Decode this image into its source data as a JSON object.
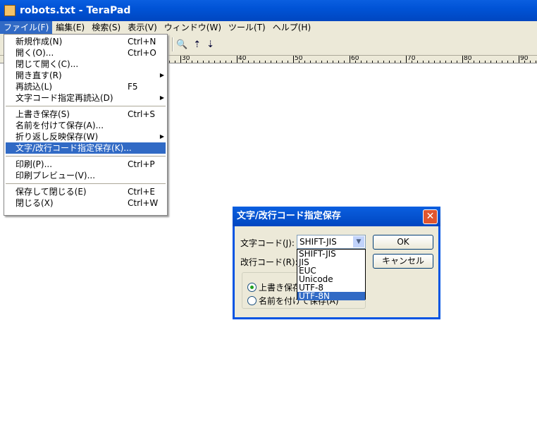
{
  "window": {
    "title": "robots.txt - TeraPad"
  },
  "menubar": [
    "ファイル(F)",
    "編集(E)",
    "検索(S)",
    "表示(V)",
    "ウィンドウ(W)",
    "ツール(T)",
    "ヘルプ(H)"
  ],
  "ruler": [
    "30",
    "40",
    "50",
    "60",
    "70",
    "80",
    "90"
  ],
  "file_menu": {
    "groups": [
      [
        {
          "label": "新規作成(N)",
          "shortcut": "Ctrl+N"
        },
        {
          "label": "開く(O)...",
          "shortcut": "Ctrl+O"
        },
        {
          "label": "閉じて開く(C)...",
          "shortcut": ""
        },
        {
          "label": "開き直す(R)",
          "shortcut": "",
          "submenu": true
        },
        {
          "label": "再読込(L)",
          "shortcut": "F5"
        },
        {
          "label": "文字コード指定再読込(D)",
          "shortcut": "",
          "submenu": true
        }
      ],
      [
        {
          "label": "上書き保存(S)",
          "shortcut": "Ctrl+S"
        },
        {
          "label": "名前を付けて保存(A)...",
          "shortcut": ""
        },
        {
          "label": "折り返し反映保存(W)",
          "shortcut": "",
          "submenu": true
        },
        {
          "label": "文字/改行コード指定保存(K)...",
          "shortcut": "",
          "selected": true
        }
      ],
      [
        {
          "label": "印刷(P)...",
          "shortcut": "Ctrl+P"
        },
        {
          "label": "印刷プレビュー(V)...",
          "shortcut": ""
        }
      ],
      [
        {
          "label": "保存して閉じる(E)",
          "shortcut": "Ctrl+E"
        },
        {
          "label": "閉じる(X)",
          "shortcut": "Ctrl+W"
        }
      ]
    ]
  },
  "dialog": {
    "title": "文字/改行コード指定保存",
    "charcode_label": "文字コード(J):",
    "charcode_value": "SHIFT-JIS",
    "charcode_options": [
      "SHIFT-JIS",
      "JIS",
      "EUC",
      "Unicode",
      "UTF-8",
      "UTF-8N"
    ],
    "highlighted_option": "UTF-8N",
    "newline_label": "改行コード(R):",
    "radio_overwrite": "上書き保存",
    "radio_saveas": "名前を付けて保存(A)",
    "ok": "OK",
    "cancel": "キャンセル"
  }
}
